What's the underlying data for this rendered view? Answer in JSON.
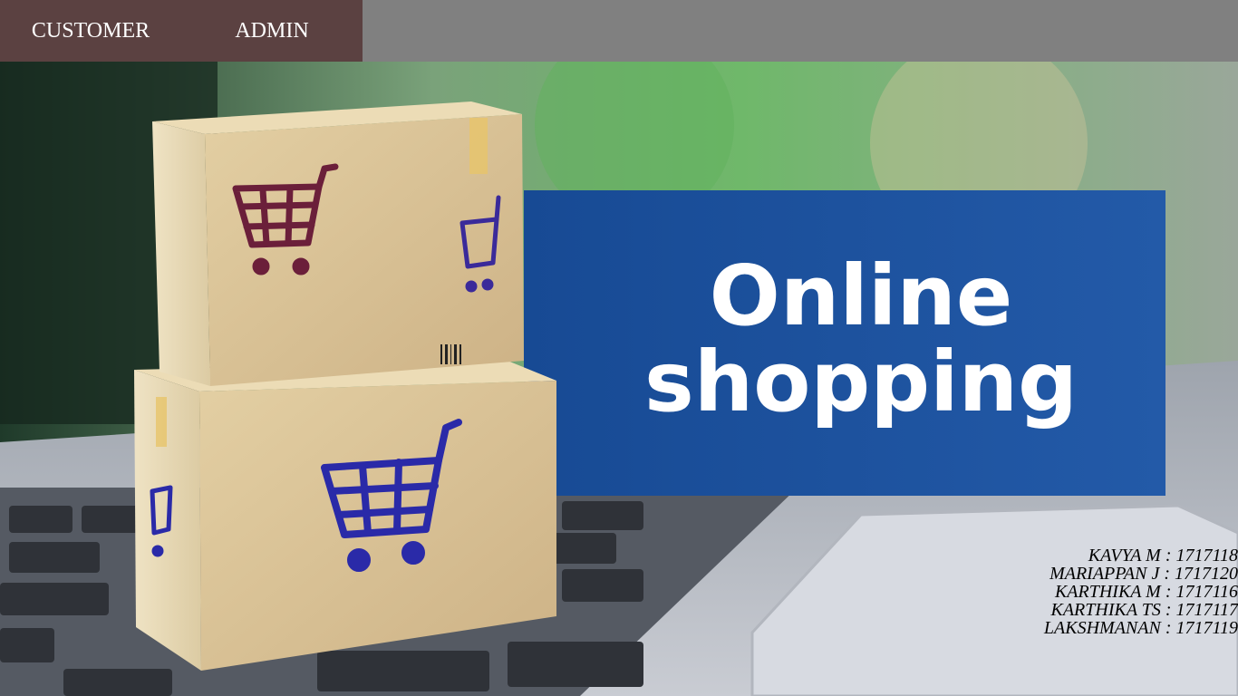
{
  "nav": {
    "customer_label": "CUSTOMER",
    "admin_label": "ADMIN"
  },
  "hero": {
    "image_text": [
      "Online",
      "shopping"
    ],
    "icons": [
      "shopping-cart-icon"
    ]
  },
  "credits": [
    "KAVYA M : 1717118",
    "MARIAPPAN J : 1717120",
    "KARTHIKA M : 1717116",
    "KARTHIKA TS : 1717117",
    "LAKSHMANAN : 1717119"
  ],
  "colors": {
    "nav_background": "#5b4141",
    "topbar_background": "#808080",
    "banner_blue": "#1d4f9c",
    "cart_maroon": "#6b1f3a",
    "cart_blue": "#2a2aa8"
  }
}
